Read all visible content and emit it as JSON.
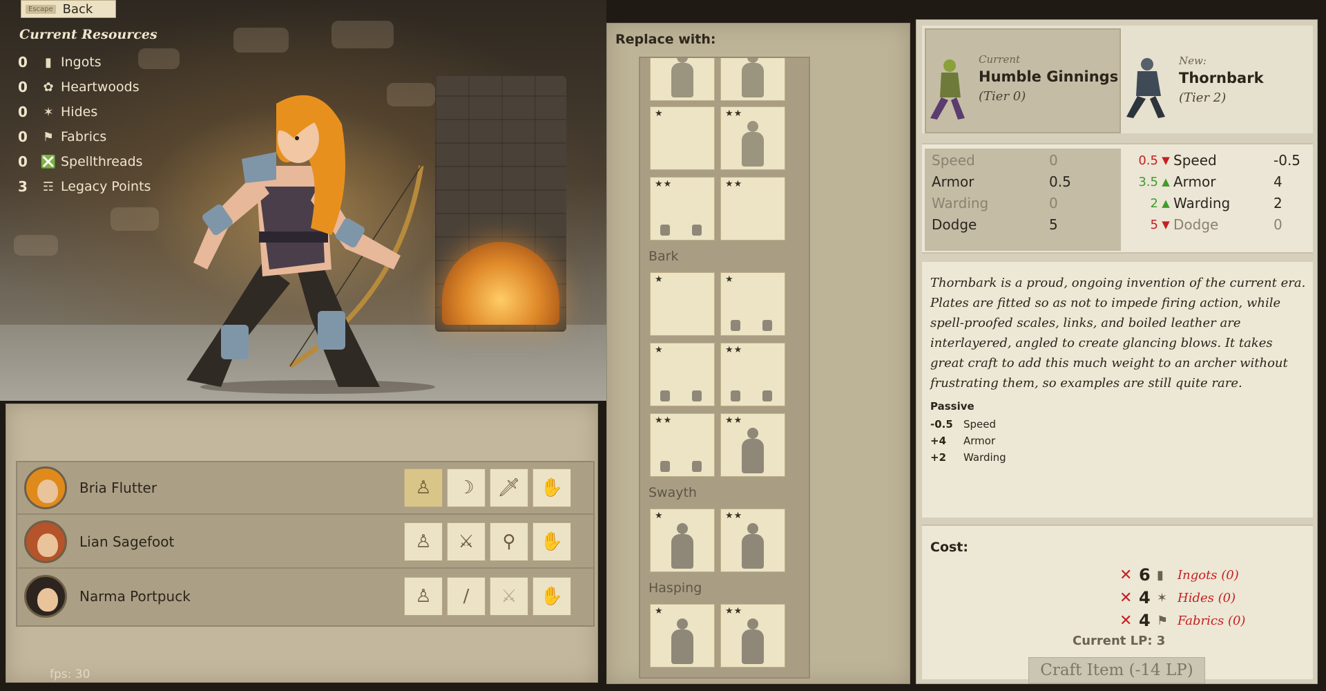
{
  "back": {
    "key": "Escape",
    "label": "Back"
  },
  "resources": {
    "title": "Current Resources",
    "items": [
      {
        "count": "0",
        "label": "Ingots",
        "icon": "ingot-icon"
      },
      {
        "count": "0",
        "label": "Heartwoods",
        "icon": "heartwood-icon"
      },
      {
        "count": "0",
        "label": "Hides",
        "icon": "hide-icon"
      },
      {
        "count": "0",
        "label": "Fabrics",
        "icon": "fabric-icon"
      },
      {
        "count": "0",
        "label": "Spellthreads",
        "icon": "spellthread-icon"
      },
      {
        "count": "3",
        "label": "Legacy Points",
        "icon": "book-icon"
      }
    ]
  },
  "fps": "fps: 30",
  "party": [
    {
      "name": "Bria Flutter",
      "hair": "#e08a1c",
      "slots": [
        "armor-figure",
        "bow",
        "dagger",
        "hand"
      ]
    },
    {
      "name": "Lian Sagefoot",
      "hair": "#b5532a",
      "slots": [
        "armor-figure",
        "sword",
        "club",
        "hand"
      ]
    },
    {
      "name": "Narma Portpuck",
      "hair": "#2d2420",
      "slots": [
        "armor-figure",
        "spear",
        "sword-2",
        "hand"
      ]
    }
  ],
  "replace": {
    "title": "Replace with:",
    "sections": [
      "Bark",
      "Swayth",
      "Hasping"
    ],
    "tiles": {
      "top": [
        "",
        "",
        "★",
        "★★",
        "★★",
        "★★"
      ],
      "bark": [
        "★",
        "★",
        "★",
        "★★",
        "★★",
        "★★"
      ],
      "swayth": [
        "★",
        "★★"
      ],
      "hasping": [
        "★",
        "★★"
      ]
    }
  },
  "detail": {
    "current_label": "Current",
    "current_name": "Humble Ginnings",
    "current_tier": "(Tier 0)",
    "new_label": "New:",
    "new_name": "Thornbark",
    "new_tier": "(Tier 2)",
    "stats_current": [
      {
        "name": "Speed",
        "value": "0"
      },
      {
        "name": "Armor",
        "value": "0.5"
      },
      {
        "name": "Warding",
        "value": "0"
      },
      {
        "name": "Dodge",
        "value": "5"
      }
    ],
    "stats_new": [
      {
        "delta": "0.5",
        "dir": "down",
        "name": "Speed",
        "value": "-0.5"
      },
      {
        "delta": "3.5",
        "dir": "up",
        "name": "Armor",
        "value": "4"
      },
      {
        "delta": "2",
        "dir": "up",
        "name": "Warding",
        "value": "2"
      },
      {
        "delta": "5",
        "dir": "down",
        "name": "Dodge",
        "value": "0"
      }
    ],
    "description": "Thornbark is a proud, ongoing invention of the current era. Plates are fitted so as not to impede firing action, while spell-proofed scales, links, and boiled leather are interlayered, angled to create glancing blows. It takes great craft to add this much weight to an archer without frustrating them, so examples are still quite rare.",
    "passive_title": "Passive",
    "passive": [
      {
        "mod": "-0.5",
        "stat": "Speed"
      },
      {
        "mod": "+4",
        "stat": "Armor"
      },
      {
        "mod": "+2",
        "stat": "Warding"
      }
    ],
    "cost_title": "Cost:",
    "cost": [
      {
        "qty": "6",
        "label": "Ingots (0)",
        "icon": "ingot-icon"
      },
      {
        "qty": "4",
        "label": "Hides (0)",
        "icon": "hide-icon"
      },
      {
        "qty": "4",
        "label": "Fabrics (0)",
        "icon": "fabric-icon"
      }
    ],
    "current_lp": "Current LP: 3",
    "craft_label": "Craft Item (-14 LP)"
  },
  "colors": {
    "panel": "#d6cfbc",
    "stat_up": "#3f9c2c",
    "stat_down": "#c42020",
    "hero_hair": "#e8901e"
  }
}
